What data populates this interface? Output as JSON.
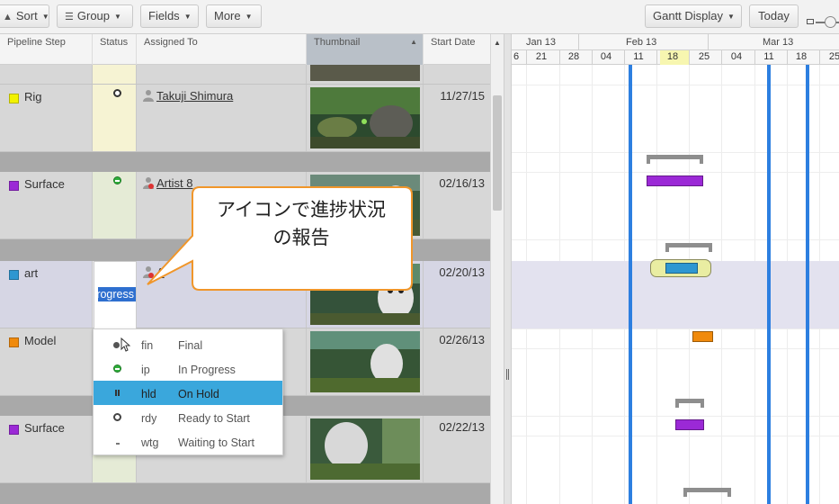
{
  "toolbar": {
    "sort_label": "Sort",
    "group_label": "Group",
    "fields_label": "Fields",
    "more_label": "More",
    "gantt_display_label": "Gantt Display",
    "today_label": "Today"
  },
  "columns": {
    "pipeline_step": "Pipeline Step",
    "status": "Status",
    "assigned_to": "Assigned To",
    "thumbnail": "Thumbnail",
    "start_date": "Start Date"
  },
  "rows": [
    {
      "step": "Rig",
      "color": "#f2f200",
      "status": "rdy",
      "assignee": "Takuji Shimura",
      "start_date": "11/27/15"
    },
    {
      "step": "Surface",
      "color": "#9b29d6",
      "status": "ip",
      "assignee": "Artist 8",
      "start_date": "02/16/13"
    },
    {
      "step": "art",
      "color": "#2e97d1",
      "status": "editing",
      "assignee": "A",
      "start_date": "02/20/13"
    },
    {
      "step": "Model",
      "color": "#f08a0c",
      "status": "",
      "assignee": "",
      "start_date": "02/26/13"
    },
    {
      "step": "Surface",
      "color": "#9b29d6",
      "status": "",
      "assignee": "",
      "start_date": "02/22/13"
    }
  ],
  "status_editor": {
    "value": "In Progress"
  },
  "status_menu": [
    {
      "code": "fin",
      "name": "Final",
      "icon": "filled-dot-icon"
    },
    {
      "code": "ip",
      "name": "In Progress",
      "icon": "in-progress-icon"
    },
    {
      "code": "hld",
      "name": "On Hold",
      "icon": "pause-icon"
    },
    {
      "code": "rdy",
      "name": "Ready to Start",
      "icon": "ready-circle-icon"
    },
    {
      "code": "wtg",
      "name": "Waiting to Start",
      "icon": "dash-icon"
    }
  ],
  "status_menu_highlighted": "hld",
  "callout": {
    "line1": "アイコンで進捗状況",
    "line2": "の報告"
  },
  "gantt": {
    "months": [
      "Jan 13",
      "Feb 13",
      "Mar 13"
    ],
    "days": [
      "6",
      "21",
      "28",
      "04",
      "11",
      "18",
      "25",
      "04",
      "11",
      "18",
      "25"
    ],
    "highlighted_day": "18",
    "milestone_color": "#2d7fe0"
  }
}
